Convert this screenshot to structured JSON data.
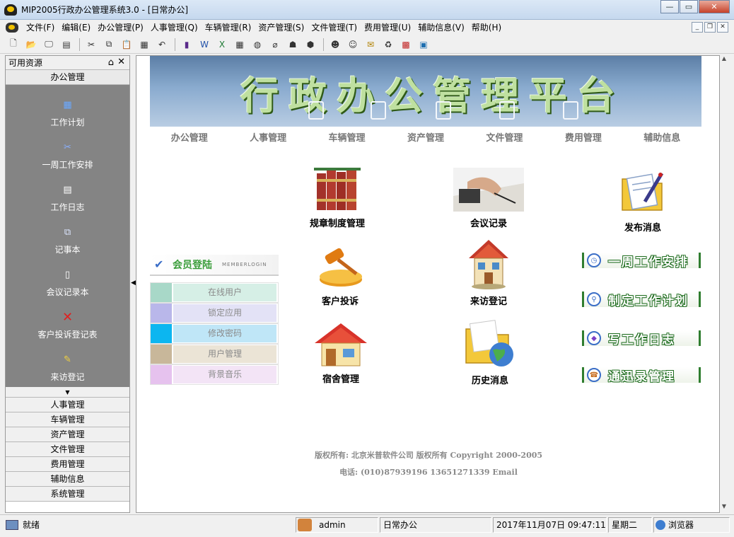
{
  "window": {
    "title": "MIP2005行政办公管理系统3.0 - [日常办公]"
  },
  "menubar": {
    "items": [
      "文件(F)",
      "编辑(E)",
      "办公管理(P)",
      "人事管理(Q)",
      "车辆管理(R)",
      "资产管理(S)",
      "文件管理(T)",
      "费用管理(U)",
      "辅助信息(V)",
      "帮助(H)"
    ]
  },
  "sidebar": {
    "header": "可用资源",
    "active_group": "办公管理",
    "items": [
      "工作计划",
      "一周工作安排",
      "工作日志",
      "记事本",
      "会议记录本",
      "客户投诉登记表",
      "来访登记"
    ],
    "groups": [
      "人事管理",
      "车辆管理",
      "资产管理",
      "文件管理",
      "费用管理",
      "辅助信息",
      "系统管理"
    ]
  },
  "main": {
    "banner_title": "行政办公管理平台",
    "nav": [
      "办公管理",
      "人事管理",
      "车辆管理",
      "资产管理",
      "文件管理",
      "费用管理",
      "辅助信息"
    ],
    "features": {
      "rules": "规章制度管理",
      "meeting": "会议记录",
      "publish": "发布消息",
      "complaint": "客户投诉",
      "visitor": "来访登记",
      "dorm": "宿舍管理",
      "history": "历史消息"
    },
    "shortcuts": [
      "一周工作安排",
      "制定工作计划",
      "写工作日志",
      "通迅录管理"
    ],
    "member": {
      "title": "会员登陆",
      "subtitle": "MEMBERLOGIN",
      "rows": [
        {
          "label": "在线用户",
          "swatch": "#a8d8c8",
          "bg": "#d6efe6"
        },
        {
          "label": "锁定应用",
          "swatch": "#b9b7ea",
          "bg": "#e3e2f6"
        },
        {
          "label": "修改密码",
          "swatch": "#0cb6f0",
          "bg": "#bfe6f7"
        },
        {
          "label": "用户管理",
          "swatch": "#c8b79a",
          "bg": "#ebe4d6"
        },
        {
          "label": "背景音乐",
          "swatch": "#e6c2ee",
          "bg": "#f3e4f6"
        }
      ]
    },
    "copyright_1": "版权所有:  北京米普软件公司 版权所有 Copyright 2000-2005",
    "copyright_2": "电话: (010)87939196  13651271339    Email"
  },
  "statusbar": {
    "ready": "就绪",
    "user": "admin",
    "module": "日常办公",
    "datetime": "2017年11月07日 09:47:11",
    "weekday": "星期二",
    "browser": "浏览器"
  }
}
